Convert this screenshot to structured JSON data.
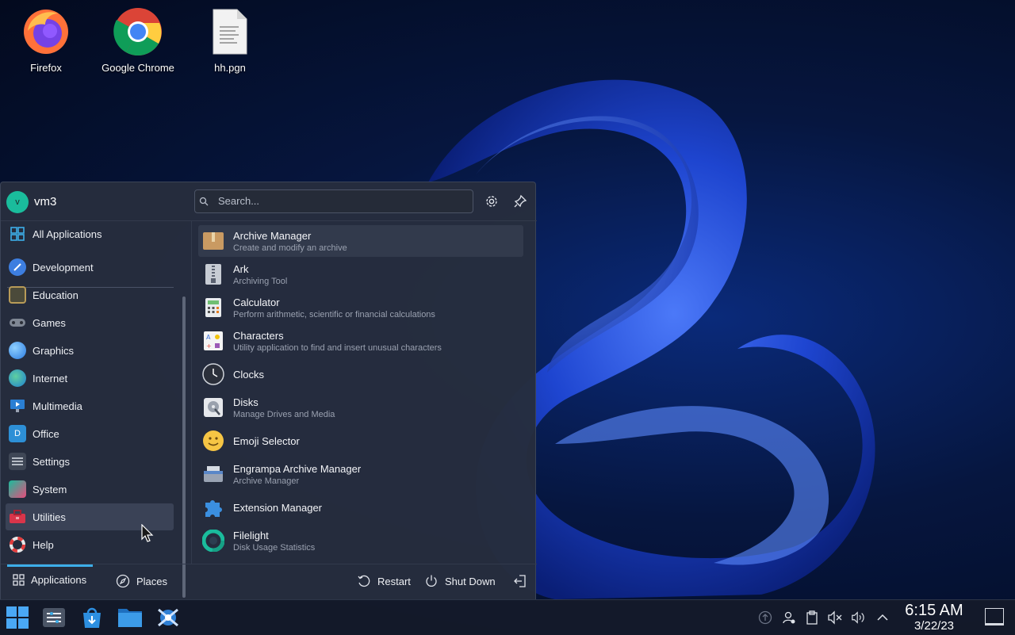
{
  "desktop": {
    "icons": [
      {
        "label": "Firefox",
        "icon": "firefox-icon"
      },
      {
        "label": "Google Chrome",
        "icon": "chrome-icon"
      },
      {
        "label": "hh.pgn",
        "icon": "text-file-icon"
      }
    ]
  },
  "menu": {
    "user": {
      "avatar_letter": "v",
      "name": "vm3"
    },
    "search": {
      "placeholder": "Search..."
    },
    "header_buttons": [
      {
        "icon": "gear-icon"
      },
      {
        "icon": "pin-icon"
      }
    ],
    "categories": [
      {
        "label": "All Applications",
        "icon": "grid-icon"
      },
      {
        "label": "Development",
        "icon": "development-icon"
      },
      {
        "label": "Education",
        "icon": "education-icon"
      },
      {
        "label": "Games",
        "icon": "gamepad-icon"
      },
      {
        "label": "Graphics",
        "icon": "graphics-icon"
      },
      {
        "label": "Internet",
        "icon": "globe-icon"
      },
      {
        "label": "Multimedia",
        "icon": "multimedia-icon"
      },
      {
        "label": "Office",
        "icon": "office-icon"
      },
      {
        "label": "Settings",
        "icon": "settings-icon"
      },
      {
        "label": "System",
        "icon": "system-icon"
      },
      {
        "label": "Utilities",
        "icon": "toolbox-icon"
      },
      {
        "label": "Help",
        "icon": "lifebuoy-icon"
      }
    ],
    "active_category": "Utilities",
    "apps": [
      {
        "name": "Archive Manager",
        "desc": "Create and modify an archive",
        "icon": "archive-box-icon"
      },
      {
        "name": "Ark",
        "desc": "Archiving Tool",
        "icon": "zip-icon"
      },
      {
        "name": "Calculator",
        "desc": "Perform arithmetic, scientific or financial calculations",
        "icon": "calculator-icon"
      },
      {
        "name": "Characters",
        "desc": "Utility application to find and insert unusual characters",
        "icon": "characters-icon"
      },
      {
        "name": "Clocks",
        "desc": "",
        "icon": "clock-icon"
      },
      {
        "name": "Disks",
        "desc": "Manage Drives and Media",
        "icon": "disk-icon"
      },
      {
        "name": "Emoji Selector",
        "desc": "",
        "icon": "emoji-icon"
      },
      {
        "name": "Engrampa Archive Manager",
        "desc": "Archive Manager",
        "icon": "engrampa-icon"
      },
      {
        "name": "Extension Manager",
        "desc": "",
        "icon": "puzzle-icon"
      },
      {
        "name": "Filelight",
        "desc": "Disk Usage Statistics",
        "icon": "filelight-icon"
      }
    ],
    "footer": {
      "applications_label": "Applications",
      "places_label": "Places",
      "restart_label": "Restart",
      "shutdown_label": "Shut Down"
    }
  },
  "taskbar": {
    "apps": [
      {
        "icon": "start-menu-icon"
      },
      {
        "icon": "system-settings-icon"
      },
      {
        "icon": "store-icon"
      },
      {
        "icon": "file-manager-icon"
      },
      {
        "icon": "network-app-icon"
      }
    ],
    "tray": [
      {
        "icon": "updates-icon"
      },
      {
        "icon": "user-switch-icon"
      },
      {
        "icon": "clipboard-icon"
      },
      {
        "icon": "mic-muted-icon"
      },
      {
        "icon": "volume-icon"
      },
      {
        "icon": "chevron-up-icon"
      }
    ],
    "clock": {
      "time": "6:15 AM",
      "date": "3/22/23"
    }
  },
  "colors": {
    "accent": "#3daee9",
    "menu_bg": "#262d3e",
    "taskbar_bg": "#141a2a"
  }
}
